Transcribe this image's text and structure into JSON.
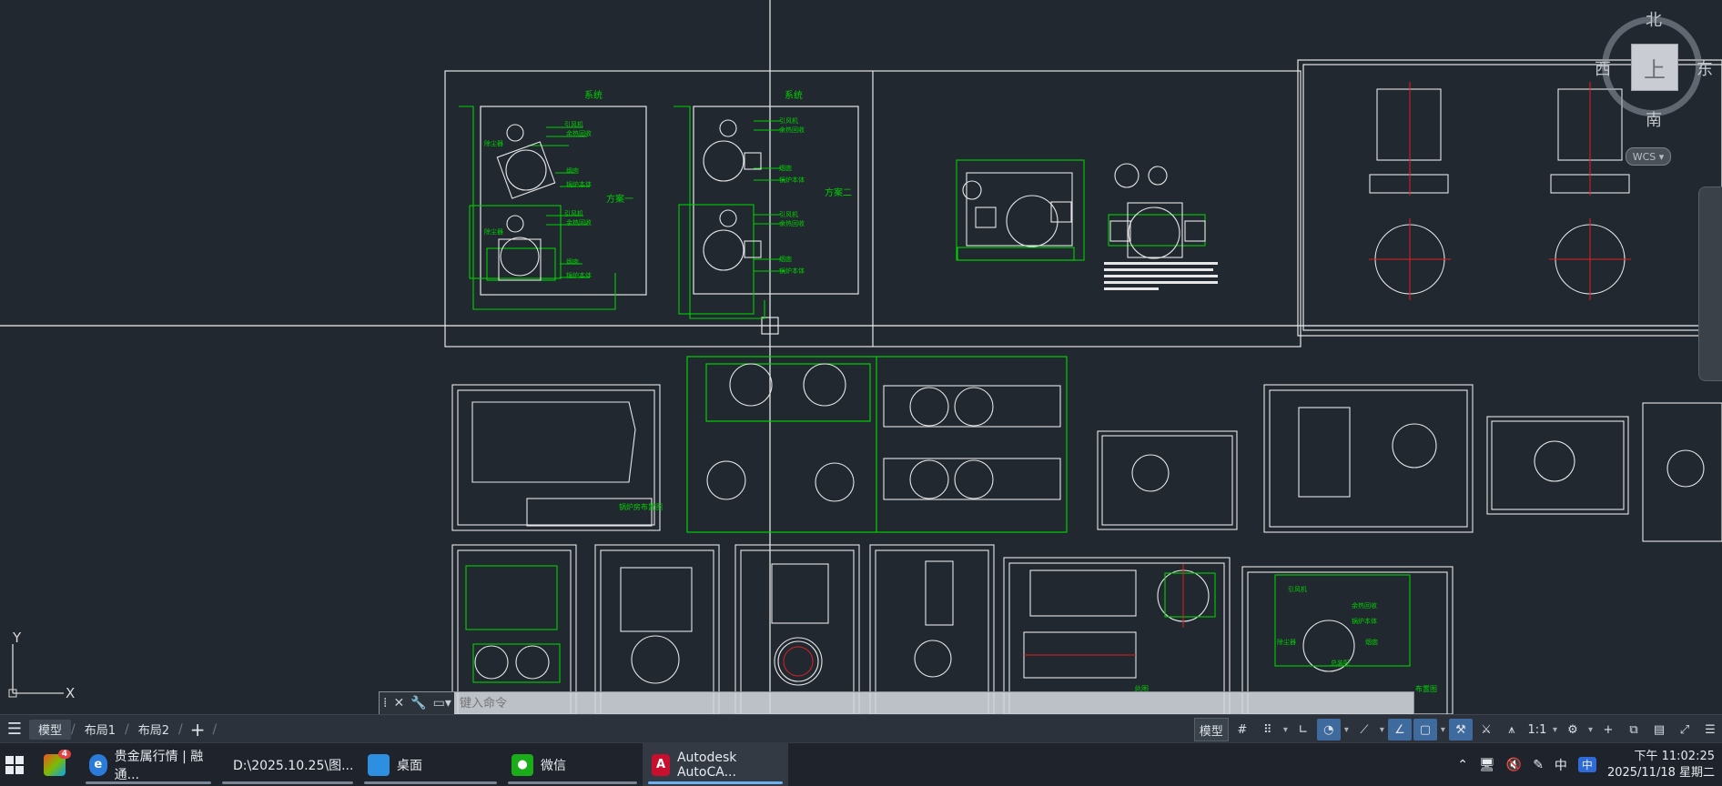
{
  "viewcube": {
    "north": "北",
    "south": "南",
    "east": "东",
    "west": "西",
    "top": "上",
    "wcs": "WCS"
  },
  "ucs": {
    "y": "Y",
    "x": "X"
  },
  "drawing_text": {
    "label_a1": "系统",
    "label_a2": "方案一",
    "label_b1": "系统",
    "label_b2": "方案二",
    "callout1": "引风机",
    "callout2": "余热回收",
    "callout3": "除尘器",
    "callout4": "烟囱",
    "callout5": "锅炉本体",
    "callout6": "引风机",
    "callout7": "余热回收",
    "callout8": "除尘器",
    "callout9": "烟囱",
    "callout10": "锅炉本体",
    "callout11": "引风机",
    "callout12": "余热回收",
    "callout13": "烟囱",
    "callout14": "锅炉本体",
    "callout15": "引风机",
    "callout16": "余热回收",
    "callout17": "烟囱",
    "callout18": "锅炉本体",
    "tb1": "锅炉房布置图",
    "tb2": "总图",
    "tb3": "布置图",
    "lower_c1": "余热回收",
    "lower_c2": "锅炉本体",
    "lower_c3": "烟囱",
    "lower_c4": "除尘器",
    "lower_c5": "引风机",
    "lower_c6": "总装配"
  },
  "command_line": {
    "placeholder": "键入命令"
  },
  "statusbar": {
    "tabs": [
      "模型",
      "布局1",
      "布局2"
    ],
    "model_label": "模型",
    "scale": "1:1"
  },
  "taskbar": {
    "apps": [
      {
        "label": "贵金属行情 | 融通...",
        "icon": "edge-icon",
        "color": "#2b7bd8"
      },
      {
        "label": "D:\\2025.10.25\\图...",
        "icon": "folder-icon",
        "color": "#e6b53a"
      },
      {
        "label": "桌面",
        "icon": "desktop-icon",
        "color": "#2e8ee0"
      },
      {
        "label": "微信",
        "icon": "wechat-icon",
        "color": "#1aad19"
      },
      {
        "label": "Autodesk AutoCA...",
        "icon": "autocad-icon",
        "color": "#c8102e"
      }
    ],
    "badge": "4",
    "ime": "中",
    "time": "下午 11:02:25",
    "date": "2025/11/18 星期二"
  },
  "colors": {
    "canvas_bg": "#212830",
    "line_white": "#e6e6e6",
    "line_green": "#00d000",
    "line_red": "#e02020",
    "accent": "#3e6a9e"
  }
}
